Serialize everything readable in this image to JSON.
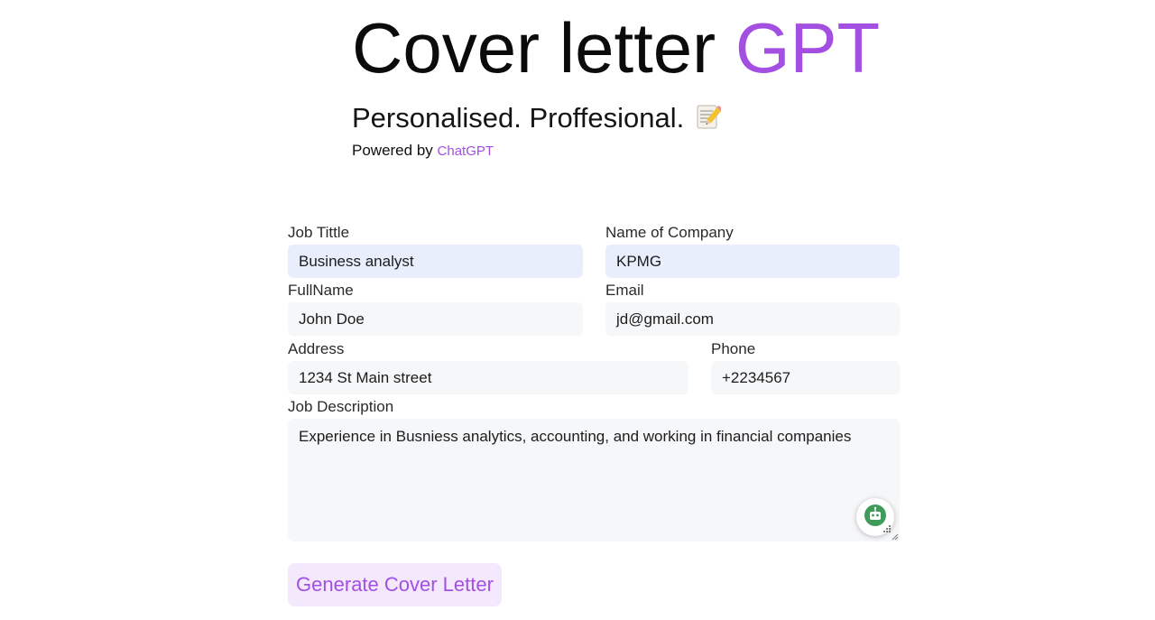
{
  "header": {
    "title_main": "Cover letter",
    "title_accent": "GPT",
    "tagline": "Personalised. Proffesional.",
    "tagline_icon": "memo-icon",
    "powered_by": "Powered by",
    "powered_link": "ChatGPT"
  },
  "form": {
    "job_title": {
      "label": "Job Tittle",
      "value": "Business analyst"
    },
    "company": {
      "label": "Name of Company",
      "value": "KPMG"
    },
    "fullname": {
      "label": "FullName",
      "value": "John Doe"
    },
    "email": {
      "label": "Email",
      "value": "jd@gmail.com"
    },
    "address": {
      "label": "Address",
      "value": "1234 St Main street"
    },
    "phone": {
      "label": "Phone",
      "value": "+2234567"
    },
    "job_description": {
      "label": "Job Description",
      "value": "Experience in Busniess analytics, accounting, and working in financial companies"
    },
    "submit_label": "Generate Cover Letter"
  },
  "extension_badge": {
    "icon": "robot-icon"
  },
  "colors": {
    "accent": "#a24fe2",
    "button_bg": "#f3e8fc",
    "input_bg": "#f6f7f9",
    "autofill_bg": "#e8eefc"
  }
}
